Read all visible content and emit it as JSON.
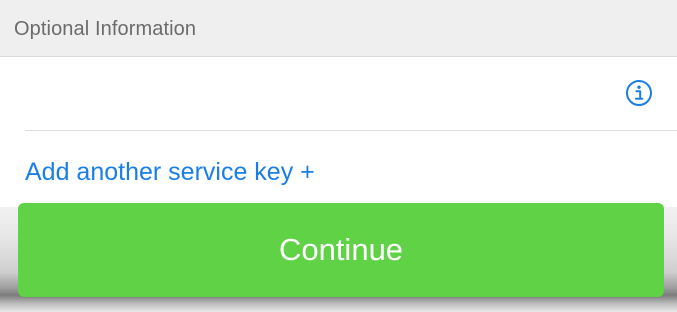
{
  "section": {
    "title": "Optional Information"
  },
  "service_key_row": {
    "icon": "info-circle-icon"
  },
  "actions": {
    "add_service_key_label": "Add another service key +",
    "continue_label": "Continue"
  },
  "colors": {
    "accent_blue": "#1a7ee8",
    "continue_green": "#5fd246"
  }
}
